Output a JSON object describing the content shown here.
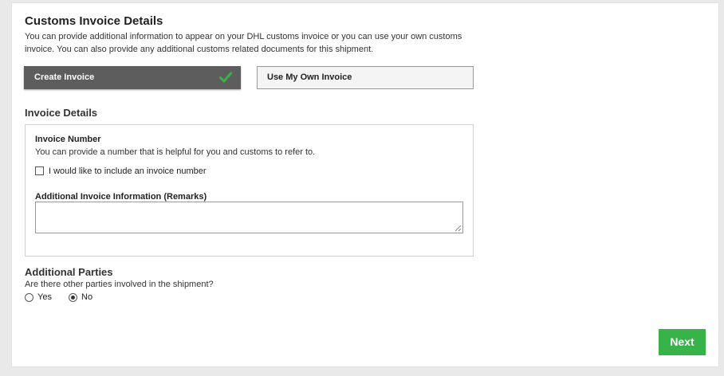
{
  "header": {
    "title": "Customs Invoice Details",
    "intro": "You can provide additional information to appear on your DHL customs invoice or you can use your own customs invoice. You can also provide any additional customs related documents for this shipment."
  },
  "invoice_options": {
    "create_label": "Create Invoice",
    "own_label": "Use My Own Invoice",
    "selected": "Create Invoice"
  },
  "invoice_details": {
    "title": "Invoice Details",
    "number_label": "Invoice Number",
    "number_help": "You can provide a number that is helpful for you and customs to refer to.",
    "checkbox_label": "I would like to include an invoice number",
    "checkbox_checked": false,
    "remarks_label": "Additional Invoice Information (Remarks)",
    "remarks_value": ""
  },
  "additional_parties": {
    "title": "Additional Parties",
    "question": "Are there other parties involved in the shipment?",
    "yes_label": "Yes",
    "no_label": "No",
    "selected": "No"
  },
  "footer": {
    "next_label": "Next"
  },
  "colors": {
    "selected_button": "#5d5d5d",
    "checkmark": "#38b34a",
    "next_button": "#38b34a"
  }
}
